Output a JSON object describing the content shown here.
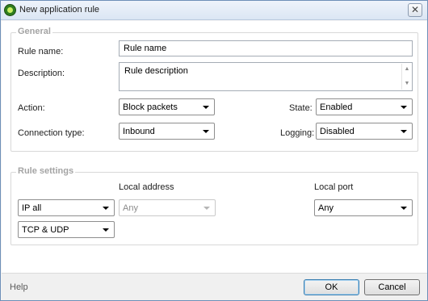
{
  "window": {
    "title": "New application rule",
    "close_glyph": "✕",
    "icon": "app-shield-icon"
  },
  "general": {
    "section_title": "General",
    "rule_name_label": "Rule name:",
    "rule_name_value": "Rule name",
    "description_label": "Description:",
    "description_value": "Rule description",
    "action_label": "Action:",
    "action_value": "Block packets",
    "state_label": "State:",
    "state_value": "Enabled",
    "connection_type_label": "Connection type:",
    "connection_type_value": "Inbound",
    "logging_label": "Logging:",
    "logging_value": "Disabled"
  },
  "rule_settings": {
    "section_title": "Rule settings",
    "local_address_label": "Local address",
    "local_port_label": "Local port",
    "ip_value": "IP all",
    "address_value": "Any",
    "port_value": "Any",
    "protocol_value": "TCP & UDP"
  },
  "footer": {
    "help_label": "Help",
    "ok_label": "OK",
    "cancel_label": "Cancel"
  },
  "scroll_glyphs": {
    "up": "▲",
    "down": "▼"
  }
}
